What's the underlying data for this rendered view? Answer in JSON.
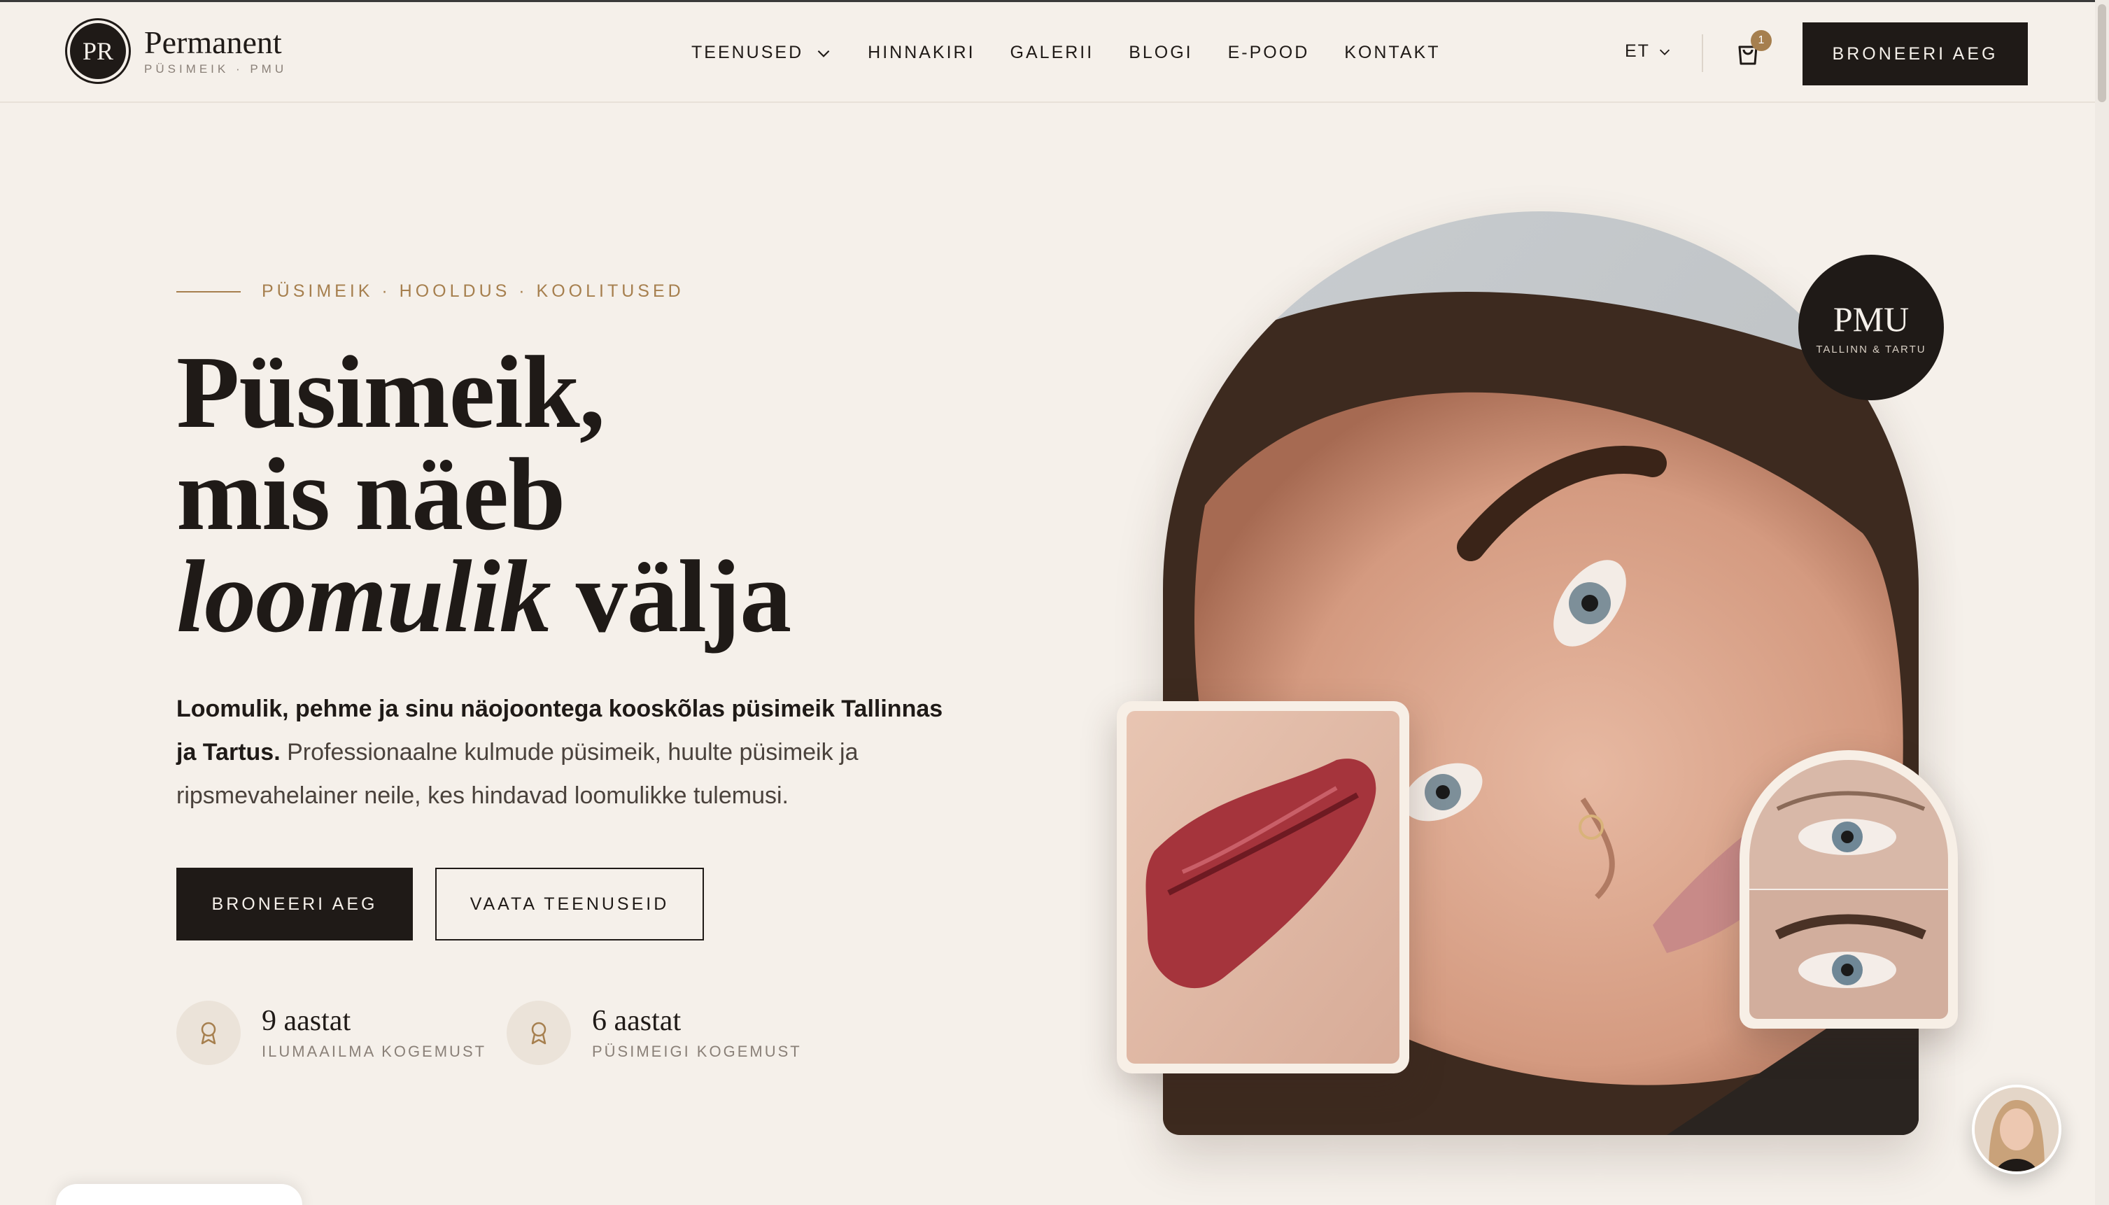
{
  "header": {
    "logo_mark": "PR",
    "logo_name": "Permanent",
    "logo_sub": "PÜSIMEIK · PMU",
    "nav": [
      {
        "label": "TEENUSED",
        "has_dropdown": true
      },
      {
        "label": "HINNAKIRI"
      },
      {
        "label": "GALERII"
      },
      {
        "label": "BLOGI"
      },
      {
        "label": "E-POOD"
      },
      {
        "label": "KONTAKT"
      }
    ],
    "language": "ET",
    "cart_count": "1",
    "book_label": "BRONEERI AEG"
  },
  "hero": {
    "eyebrow": "PÜSIMEIK · HOOLDUS · KOOLITUSED",
    "headline_line1": "Püsimeik,",
    "headline_line2": "mis näeb",
    "headline_line3_italic": "loomulik",
    "headline_line3_rest": " välja",
    "lead_bold": "Loomulik, pehme ja sinu näojoontega kooskõlas püsimeik Tallinnas ja Tartus.",
    "lead_rest": " Professionaalne kulmude püsimeik, huulte püsimeik ja ripsmevahelainer neile, kes hindavad loomulikke tulemusi.",
    "cta_primary": "BRONEERI AEG",
    "cta_secondary": "VAATA TEENUSEID",
    "stats": [
      {
        "value": "9 aastat",
        "label": "ILUMAAILMA KOGEMUST",
        "icon": "award-icon"
      },
      {
        "value": "6 aastat",
        "label": "PÜSIMEIGI KOGEMUST",
        "icon": "award-icon"
      }
    ],
    "badge_title": "PMU",
    "badge_sub": "TALLINN & TARTU"
  },
  "colors": {
    "background": "#f5f0ea",
    "dark": "#1f1a17",
    "accent": "#a67f4e"
  }
}
